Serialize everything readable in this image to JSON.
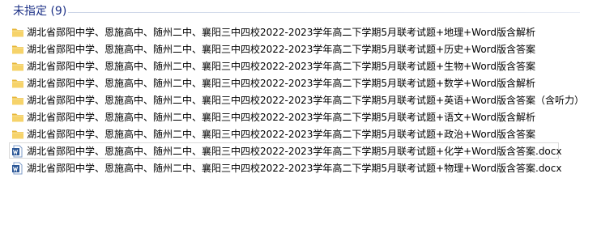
{
  "group": {
    "title": "未指定 (9)"
  },
  "files": [
    {
      "name": "湖北省郧阳中学、恩施高中、随州二中、襄阳三中四校2022-2023学年高二下学期5月联考试题+地理+Word版含解析",
      "icon": "folder-icon"
    },
    {
      "name": "湖北省郧阳中学、恩施高中、随州二中、襄阳三中四校2022-2023学年高二下学期5月联考试题+历史+Word版含答案",
      "icon": "folder-icon"
    },
    {
      "name": "湖北省郧阳中学、恩施高中、随州二中、襄阳三中四校2022-2023学年高二下学期5月联考试题+生物+Word版含答案",
      "icon": "folder-icon"
    },
    {
      "name": "湖北省郧阳中学、恩施高中、随州二中、襄阳三中四校2022-2023学年高二下学期5月联考试题+数学+Word版含解析",
      "icon": "folder-icon"
    },
    {
      "name": "湖北省郧阳中学、恩施高中、随州二中、襄阳三中四校2022-2023学年高二下学期5月联考试题+英语+Word版含答案（含听力）",
      "icon": "folder-icon"
    },
    {
      "name": "湖北省郧阳中学、恩施高中、随州二中、襄阳三中四校2022-2023学年高二下学期5月联考试题+语文+Word版含解析",
      "icon": "folder-icon"
    },
    {
      "name": "湖北省郧阳中学、恩施高中、随州二中、襄阳三中四校2022-2023学年高二下学期5月联考试题+政治+Word版含答案",
      "icon": "folder-icon"
    },
    {
      "name": "湖北省郧阳中学、恩施高中、随州二中、襄阳三中四校2022-2023学年高二下学期5月联考试题+化学+Word版含答案.docx",
      "icon": "word-document-icon"
    },
    {
      "name": "湖北省郧阳中学、恩施高中、随州二中、襄阳三中四校2022-2023学年高二下学期5月联考试题+物理+Word版含答案.docx",
      "icon": "word-document-icon"
    }
  ],
  "colors": {
    "group_title": "#1e3287",
    "folder": "#f3c94a",
    "word_blue": "#2b5797"
  }
}
